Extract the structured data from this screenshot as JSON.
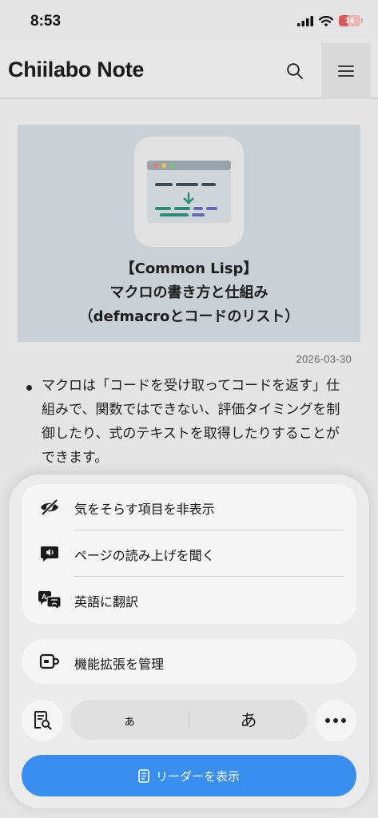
{
  "status_bar": {
    "time": "8:53",
    "battery_level": "14"
  },
  "site": {
    "title": "Chiilabo Note"
  },
  "article": {
    "title_lines": [
      "【Common Lisp】",
      "マクロの書き方と仕組み",
      "（defmacroとコードのリスト）"
    ],
    "date": "2026-03-30",
    "paragraph_lines": [
      "マクロは「コードを受け取ってコードを返す」仕",
      "組みで、関数ではできない、評価タイミングを制",
      "御したり、式のテキストを取得したりすることが",
      "できます。"
    ]
  },
  "sheet": {
    "menu_items": [
      {
        "label": "気をそらす項目を非表示",
        "icon": "eye-slash-icon"
      },
      {
        "label": "ページの読み上げを聞く",
        "icon": "speech-bubble-speaker-icon"
      },
      {
        "label": "英語に翻訳",
        "icon": "translate-icon"
      }
    ],
    "extensions": {
      "label": "機能拡張を管理",
      "icon": "puzzle-icon"
    },
    "font_small": "ぁ",
    "font_large": "あ",
    "reader_button": {
      "label": "リーダーを表示",
      "icon": "reader-doc-icon"
    }
  },
  "colors": {
    "accent": "#3a8ef0",
    "hero_bg": "#c9d1d6",
    "battery": "#d9595a"
  }
}
